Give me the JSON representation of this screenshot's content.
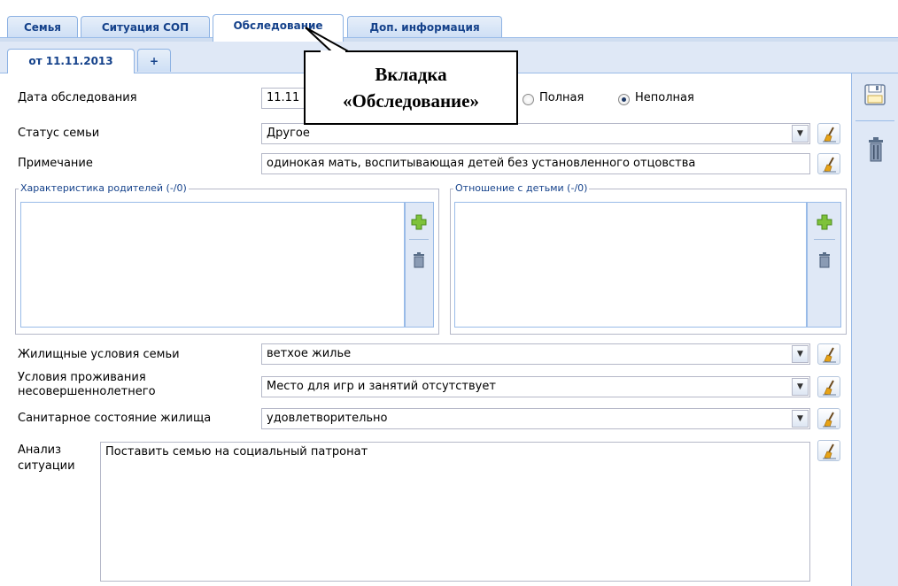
{
  "tabs": [
    "Семья",
    "Ситуация СОП",
    "Обследование",
    "Доп. информация"
  ],
  "subtabs": {
    "date_tab": "от 11.11.2013",
    "add": "+"
  },
  "callout": {
    "line1": "Вкладка",
    "line2": "«Обследование»"
  },
  "form": {
    "exam_date_label": "Дата обследования",
    "exam_date_value": "11.11",
    "radio_full": "Полная",
    "radio_partial": "Неполная",
    "family_status_label": "Статус семьи",
    "family_status_value": "Другое",
    "note_label": "Примечание",
    "note_value": "одинокая мать, воспитывающая детей без установленного отцовства",
    "parents_legend": "Характеристика родителей (-/0)",
    "children_legend": "Отношение с детьми (-/0)",
    "housing_label": "Жилищные условия семьи",
    "housing_value": "ветхое жилье",
    "living_label_1": "Условия проживания",
    "living_label_2": "несовершеннолетнего",
    "living_value": "Место для игр и занятий отсутствует",
    "sanitary_label": "Санитарное состояние жилища",
    "sanitary_value": "удовлетворительно",
    "analysis_label_1": "Анализ",
    "analysis_label_2": "ситуации",
    "analysis_value": "Поставить семью на социальный патронат"
  },
  "colors": {
    "tab_text": "#15428b",
    "panel_bg": "#dfe8f6",
    "border": "#99bbe8"
  }
}
